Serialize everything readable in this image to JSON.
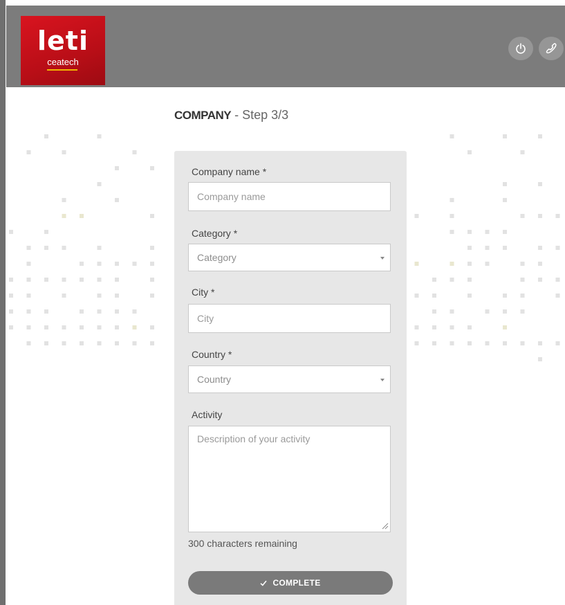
{
  "header": {
    "logo": {
      "main": "leti",
      "sub": "ceatech"
    },
    "power_icon": "power-icon",
    "phone_icon": "phone-icon"
  },
  "form": {
    "title_company": "COMPANY",
    "title_step": " - Step 3/3",
    "fields": {
      "company_name": {
        "label": "Company name *",
        "placeholder": "Company name"
      },
      "category": {
        "label": "Category *",
        "selected": "Category"
      },
      "city": {
        "label": "City *",
        "placeholder": "City"
      },
      "country": {
        "label": "Country *",
        "selected": "Country"
      },
      "activity": {
        "label": "Activity",
        "placeholder": "Description of your activity"
      }
    },
    "remaining": "300 characters remaining",
    "complete_label": "COMPLETE",
    "complete_icon": "check-icon"
  },
  "colors": {
    "header_bg": "#7c7c7c",
    "logo_red": "#c8101a",
    "panel_bg": "#e7e7e7",
    "button_bg": "#7a7a7a"
  }
}
